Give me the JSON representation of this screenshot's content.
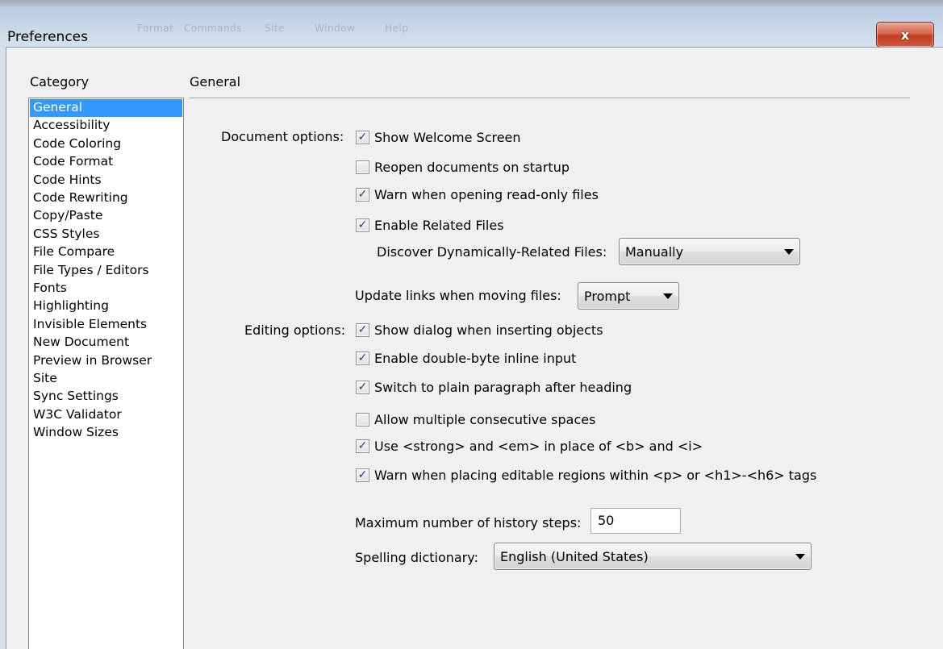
{
  "window": {
    "title": "Preferences",
    "ghost_menu": [
      "Format",
      "Commands",
      "Site",
      "Window",
      "Help"
    ],
    "close_label": "x"
  },
  "category": {
    "header": "Category",
    "selected_index": 0,
    "items": [
      "General",
      "Accessibility",
      "Code Coloring",
      "Code Format",
      "Code Hints",
      "Code Rewriting",
      "Copy/Paste",
      "CSS Styles",
      "File Compare",
      "File Types / Editors",
      "Fonts",
      "Highlighting",
      "Invisible Elements",
      "New Document",
      "Preview in Browser",
      "Site",
      "Sync Settings",
      "W3C Validator",
      "Window Sizes"
    ]
  },
  "general": {
    "section_title": "General",
    "document_options_label": "Document options:",
    "editing_options_label": "Editing options:",
    "document_options": [
      {
        "label": "Show Welcome Screen",
        "checked": true
      },
      {
        "label": "Reopen documents on startup",
        "checked": false
      },
      {
        "label": "Warn when opening read-only files",
        "checked": true
      },
      {
        "label": "Enable Related Files",
        "checked": true
      }
    ],
    "discover_label": "Discover Dynamically-Related Files:",
    "discover_value": "Manually",
    "update_links_label": "Update links when moving files:",
    "update_links_value": "Prompt",
    "editing_options": [
      {
        "label": "Show dialog when inserting objects",
        "checked": true
      },
      {
        "label": "Enable double-byte inline input",
        "checked": true
      },
      {
        "label": "Switch to plain paragraph after heading",
        "checked": true
      },
      {
        "label": "Allow multiple consecutive spaces",
        "checked": false
      },
      {
        "label": "Use <strong> and <em> in place of <b> and <i>",
        "checked": true
      },
      {
        "label": "Warn when placing editable regions within <p> or <h1>-<h6> tags",
        "checked": true
      }
    ],
    "history_label": "Maximum number of history steps:",
    "history_value": "50",
    "spelling_label": "Spelling dictionary:",
    "spelling_value": "English (United States)"
  },
  "colors": {
    "selection": "#3399ff",
    "check_mark": "#243f8f",
    "close_button": "#c13d22"
  }
}
